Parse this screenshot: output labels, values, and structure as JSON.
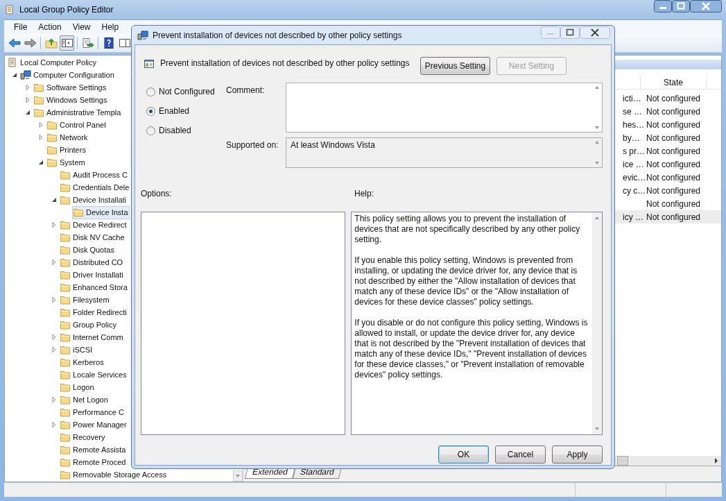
{
  "window": {
    "title": "Local Group Policy Editor"
  },
  "menu": [
    {
      "label": "File"
    },
    {
      "label": "Action"
    },
    {
      "label": "View"
    },
    {
      "label": "Help"
    }
  ],
  "toolbar": [
    {
      "kind": "back",
      "pressed": false
    },
    {
      "kind": "forward",
      "pressed": false
    },
    {
      "kind": "up",
      "pressed": false
    },
    {
      "kind": "tree",
      "pressed": true
    },
    {
      "kind": "export",
      "pressed": false
    },
    {
      "kind": "help",
      "pressed": false
    },
    {
      "kind": "pane",
      "pressed": false
    }
  ],
  "tree": [
    {
      "label": "Local Computer Policy",
      "kind": "policy",
      "selected": false,
      "children": [
        {
          "label": "Computer Configuration",
          "kind": "computer",
          "expanded": true,
          "selected": false,
          "children": [
            {
              "label": "Software Settings",
              "kind": "folder",
              "expanded": false,
              "selected": false
            },
            {
              "label": "Windows Settings",
              "kind": "folder",
              "expanded": false,
              "selected": false
            },
            {
              "label": "Administrative Templa",
              "kind": "folder",
              "expanded": true,
              "selected": false,
              "children": [
                {
                  "label": "Control Panel",
                  "kind": "folder",
                  "expanded": false,
                  "selected": false
                },
                {
                  "label": "Network",
                  "kind": "folder",
                  "expanded": false,
                  "selected": false
                },
                {
                  "label": "Printers",
                  "kind": "folder",
                  "selected": false
                },
                {
                  "label": "System",
                  "kind": "folder",
                  "expanded": true,
                  "selected": false,
                  "children": [
                    {
                      "label": "Audit Process C",
                      "kind": "folder",
                      "selected": false
                    },
                    {
                      "label": "Credentials Dele",
                      "kind": "folder",
                      "selected": false
                    },
                    {
                      "label": "Device Installati",
                      "kind": "folder",
                      "expanded": true,
                      "selected": false,
                      "children": [
                        {
                          "label": "Device Insta",
                          "kind": "folder",
                          "selected": true
                        }
                      ]
                    },
                    {
                      "label": "Device Redirect",
                      "kind": "folder",
                      "expanded": false,
                      "selected": false
                    },
                    {
                      "label": "Disk NV Cache",
                      "kind": "folder",
                      "selected": false
                    },
                    {
                      "label": "Disk Quotas",
                      "kind": "folder",
                      "selected": false
                    },
                    {
                      "label": "Distributed CO",
                      "kind": "folder",
                      "expanded": false,
                      "selected": false
                    },
                    {
                      "label": "Driver Installati",
                      "kind": "folder",
                      "selected": false
                    },
                    {
                      "label": "Enhanced Stora",
                      "kind": "folder",
                      "selected": false
                    },
                    {
                      "label": "Filesystem",
                      "kind": "folder",
                      "expanded": false,
                      "selected": false
                    },
                    {
                      "label": "Folder Redirecti",
                      "kind": "folder",
                      "selected": false
                    },
                    {
                      "label": "Group Policy",
                      "kind": "folder",
                      "selected": false
                    },
                    {
                      "label": "Internet Comm",
                      "kind": "folder",
                      "expanded": false,
                      "selected": false
                    },
                    {
                      "label": "iSCSI",
                      "kind": "folder",
                      "expanded": false,
                      "selected": false
                    },
                    {
                      "label": "Kerberos",
                      "kind": "folder",
                      "selected": false
                    },
                    {
                      "label": "Locale Services",
                      "kind": "folder",
                      "selected": false
                    },
                    {
                      "label": "Logon",
                      "kind": "folder",
                      "selected": false
                    },
                    {
                      "label": "Net Logon",
                      "kind": "folder",
                      "expanded": false,
                      "selected": false
                    },
                    {
                      "label": "Performance C",
                      "kind": "folder",
                      "selected": false
                    },
                    {
                      "label": "Power Manager",
                      "kind": "folder",
                      "expanded": false,
                      "selected": false
                    },
                    {
                      "label": "Recovery",
                      "kind": "folder",
                      "selected": false
                    },
                    {
                      "label": "Remote Assista",
                      "kind": "folder",
                      "selected": false
                    },
                    {
                      "label": "Remote Proced",
                      "kind": "folder",
                      "selected": false
                    },
                    {
                      "label": "Removable Storage Access",
                      "kind": "folder",
                      "selected": false
                    }
                  ]
                }
              ]
            }
          ]
        }
      ]
    }
  ],
  "list": {
    "columns": [
      {
        "label": "State"
      }
    ],
    "rows": [
      {
        "column_1": "icti…",
        "state": "Not configured",
        "selected": false
      },
      {
        "column_1": "se …",
        "state": "Not configured",
        "selected": false
      },
      {
        "column_1": "hes…",
        "state": "Not configured",
        "selected": false
      },
      {
        "column_1": "by…",
        "state": "Not configured",
        "selected": false
      },
      {
        "column_1": "s pr…",
        "state": "Not configured",
        "selected": false
      },
      {
        "column_1": "ice …",
        "state": "Not configured",
        "selected": false
      },
      {
        "column_1": "evic…",
        "state": "Not configured",
        "selected": false
      },
      {
        "column_1": "cy c…",
        "state": "Not configured",
        "selected": false
      },
      {
        "state": "Not configured",
        "selected": false
      },
      {
        "column_1": "icy …",
        "state": "Not configured",
        "selected": true
      }
    ]
  },
  "tabs": [
    {
      "label": "Extended",
      "selected": true
    },
    {
      "label": "Standard",
      "selected": false
    }
  ],
  "dialog": {
    "title": "Prevent installation of devices not described by other policy settings",
    "heading": "Prevent installation of devices not described by other policy settings",
    "nav_buttons": [
      {
        "label": "Previous Setting",
        "disabled": false
      },
      {
        "label": "Next Setting",
        "disabled": true
      }
    ],
    "options": [
      {
        "label": "Not Configured",
        "selected": false
      },
      {
        "label": "Enabled",
        "selected": true
      },
      {
        "label": "Disabled",
        "selected": false
      }
    ],
    "comment_label": "Comment:",
    "supported_label": "Supported on:",
    "supported_value": "At least Windows Vista",
    "options_label": "Options:",
    "help_label": "Help:",
    "help": [
      "This policy setting allows you to prevent the installation of devices that are not specifically described by any other policy setting.",
      "If you enable this policy setting, Windows is prevented from installing, or updating the device driver for, any device that is not described by either the \"Allow installation of devices that match any of these device IDs\" or the \"Allow installation of devices for these device classes\" policy settings.",
      "If you disable or do not configure this policy setting, Windows is allowed to install, or update the device driver for, any device that is not described by the \"Prevent installation of devices that match any of these device IDs,\" \"Prevent installation of devices for these device classes,\" or \"Prevent installation of removable devices\" policy settings."
    ],
    "buttons": [
      {
        "label": "OK",
        "default": true
      },
      {
        "label": "Cancel",
        "default": false
      },
      {
        "label": "Apply",
        "default": false
      }
    ]
  }
}
